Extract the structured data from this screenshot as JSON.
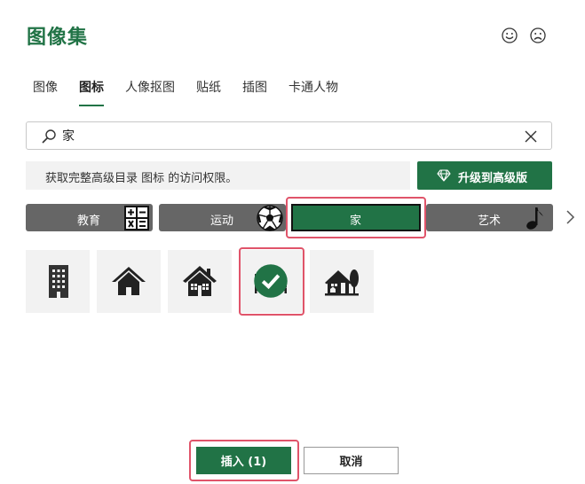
{
  "dialog": {
    "title": "图像集"
  },
  "feedback": {
    "smile_icon": "smile-icon",
    "frown_icon": "frown-icon"
  },
  "tabs": [
    {
      "label": "图像",
      "active": false
    },
    {
      "label": "图标",
      "active": true
    },
    {
      "label": "人像抠图",
      "active": false
    },
    {
      "label": "贴纸",
      "active": false
    },
    {
      "label": "插图",
      "active": false
    },
    {
      "label": "卡通人物",
      "active": false
    }
  ],
  "search": {
    "value": "家",
    "placeholder": ""
  },
  "banner": {
    "text": "获取完整高级目录 图标 的访问权限。",
    "upgrade_label": "升级到高级版"
  },
  "categories": [
    {
      "label": "教育",
      "icon": "calculator-icon"
    },
    {
      "label": "运动",
      "icon": "soccer-ball-icon"
    },
    {
      "label": "家",
      "icon": "",
      "selected": true
    },
    {
      "label": "艺术",
      "icon": "music-note-icon"
    }
  ],
  "results": [
    {
      "icon": "apartment-building-icon",
      "selected": false
    },
    {
      "icon": "house-icon",
      "selected": false
    },
    {
      "icon": "house-with-windows-icon",
      "selected": false
    },
    {
      "icon": "person-in-bed-icon",
      "selected": true
    },
    {
      "icon": "home-with-tree-icon",
      "selected": false
    }
  ],
  "footer": {
    "insert_label": "插入 (1)",
    "cancel_label": "取消"
  },
  "colors": {
    "accent": "#217346",
    "category_bg": "#666666",
    "highlight": "#e0546a",
    "tile_bg": "#f2f2f2"
  }
}
